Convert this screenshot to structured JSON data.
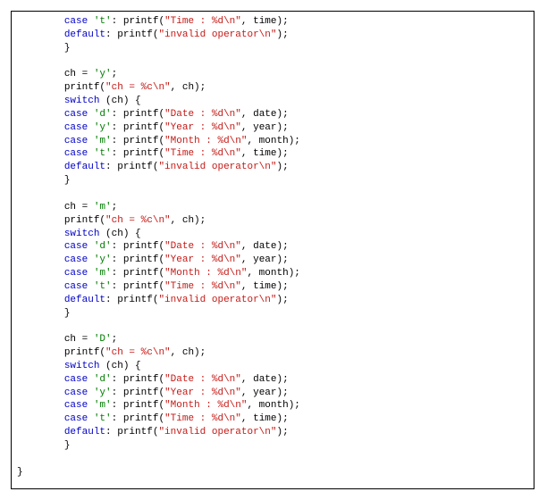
{
  "code": {
    "indent_unit": "        ",
    "kw_case": "case",
    "kw_default": "default",
    "kw_switch": "switch",
    "chr_t": "'t'",
    "chr_d": "'d'",
    "chr_y": "'y'",
    "chr_m": "'m'",
    "chr_D": "'D'",
    "str_time": "\"Time : %d\\n\"",
    "str_date": "\"Date : %d\\n\"",
    "str_year": "\"Year : %d\\n\"",
    "str_month": "\"Month : %d\\n\"",
    "str_invalid": "\"invalid operator\\n\"",
    "str_ch_fmt": "\"ch = %c\\n\"",
    "txt_printf_open": ": printf(",
    "txt_printf_plain": "printf(",
    "txt_comma_time": ", time);",
    "txt_comma_date": ", date);",
    "txt_comma_year": ", year);",
    "txt_comma_month": ", month);",
    "txt_comma_ch": ", ch);",
    "txt_close_stmt": ");",
    "txt_brace_close": "}",
    "txt_ch_eq": "ch = ",
    "txt_semi": ";",
    "txt_space": " ",
    "txt_switch_tail": " (ch) {",
    "txt_final_brace": "}"
  }
}
